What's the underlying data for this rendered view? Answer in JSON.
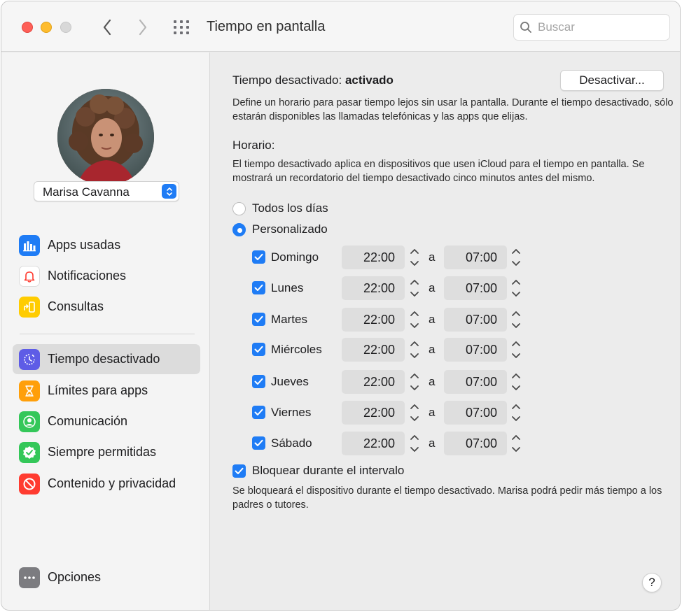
{
  "window": {
    "title": "Tiempo en pantalla",
    "search_placeholder": "Buscar"
  },
  "user": {
    "name": "Marisa Cavanna"
  },
  "sidebar": {
    "items": [
      {
        "label": "Apps usadas",
        "icon": "bar-chart-icon",
        "color": "#1f7cf5"
      },
      {
        "label": "Notificaciones",
        "icon": "bell-icon",
        "color": "#ffffff"
      },
      {
        "label": "Consultas",
        "icon": "pickup-phone-icon",
        "color": "#ffcc00"
      },
      {
        "label": "Tiempo desactivado",
        "icon": "downtime-icon",
        "color": "#5e5ce6",
        "selected": true
      },
      {
        "label": "Límites para apps",
        "icon": "hourglass-icon",
        "color": "#ff9f0a"
      },
      {
        "label": "Comunicación",
        "icon": "person-icon",
        "color": "#34c759"
      },
      {
        "label": "Siempre permitidas",
        "icon": "checkmark-seal-icon",
        "color": "#34c759"
      },
      {
        "label": "Contenido y privacidad",
        "icon": "no-entry-icon",
        "color": "#ff3b30"
      }
    ],
    "options_label": "Opciones"
  },
  "main": {
    "status_prefix": "Tiempo desactivado: ",
    "status_value": "activado",
    "deactivate_button": "Desactivar...",
    "description": "Define un horario para pasar tiempo lejos sin usar la pantalla. Durante el tiempo desactivado, sólo estarán disponibles las llamadas telefónicas y las apps que elijas.",
    "schedule_label": "Horario:",
    "schedule_note": "El tiempo desactivado aplica en dispositivos que usen iCloud para el tiempo en pantalla. Se mostrará un recordatorio del tiempo desactivado cinco minutos antes del mismo.",
    "radio_every_day": "Todos los días",
    "radio_custom": "Personalizado",
    "selected_schedule": "Personalizado",
    "separator": "a",
    "days": [
      {
        "name": "Domingo",
        "checked": true,
        "from": "22:00",
        "to": "07:00"
      },
      {
        "name": "Lunes",
        "checked": true,
        "from": "22:00",
        "to": "07:00"
      },
      {
        "name": "Martes",
        "checked": true,
        "from": "22:00",
        "to": "07:00"
      },
      {
        "name": "Miércoles",
        "checked": true,
        "from": "22:00",
        "to": "07:00"
      },
      {
        "name": "Jueves",
        "checked": true,
        "from": "22:00",
        "to": "07:00"
      },
      {
        "name": "Viernes",
        "checked": true,
        "from": "22:00",
        "to": "07:00"
      },
      {
        "name": "Sábado",
        "checked": true,
        "from": "22:00",
        "to": "07:00"
      }
    ],
    "block_label": "Bloquear durante el intervalo",
    "block_checked": true,
    "block_note": "Se bloqueará el dispositivo durante el tiempo desactivado. Marisa podrá pedir más tiempo a los padres o tutores.",
    "help_label": "?"
  },
  "colors": {
    "accent": "#1f7cf5",
    "window_bg": "#ececec",
    "sidebar_bg": "#f4f4f4"
  }
}
